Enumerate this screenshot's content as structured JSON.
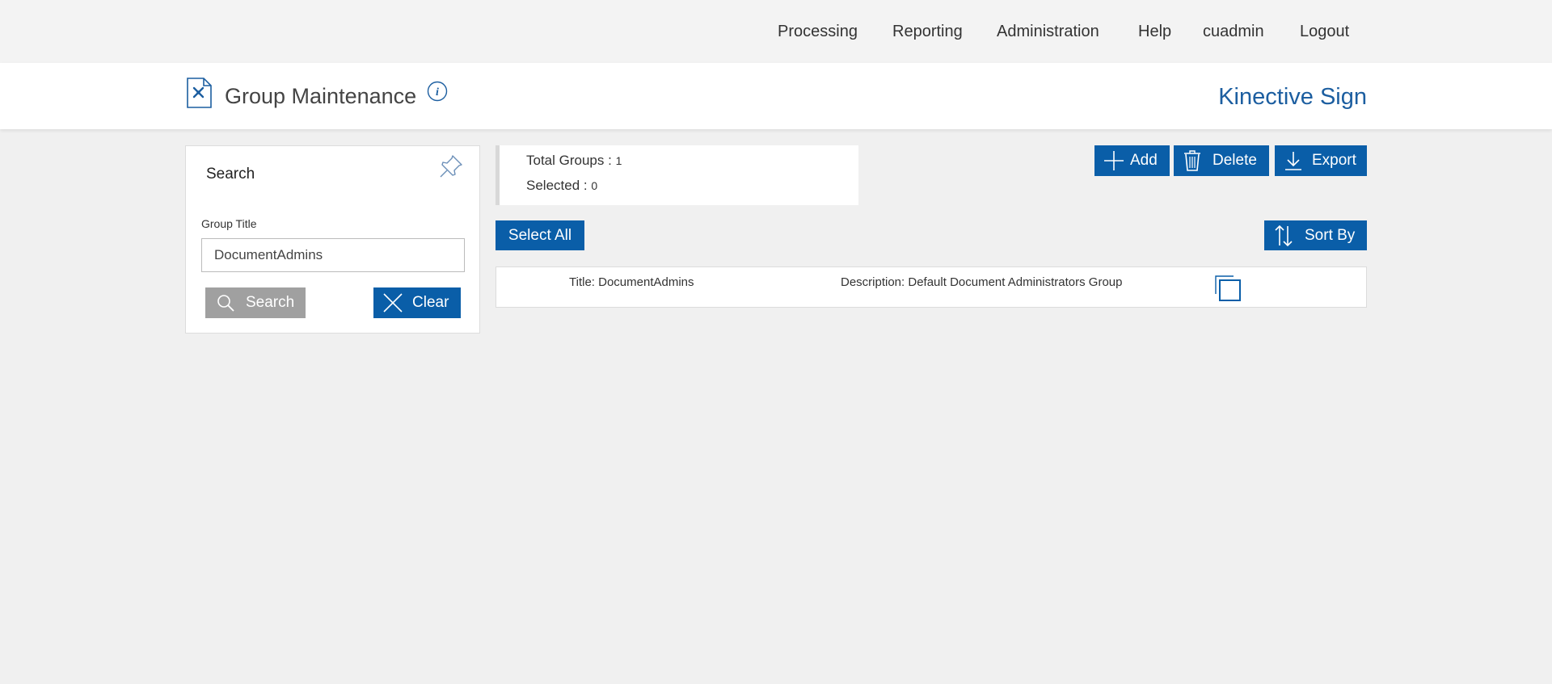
{
  "nav": {
    "items": [
      "Processing",
      "Reporting",
      "Administration",
      "Help",
      "cuadmin",
      "Logout"
    ]
  },
  "header": {
    "page_title": "Group Maintenance",
    "brand": "Kinective Sign",
    "page_icon": "document-tools-icon",
    "info_icon": "info-icon"
  },
  "search_panel": {
    "heading": "Search",
    "field_label": "Group Title",
    "field_value": "DocumentAdmins",
    "search_button": "Search",
    "clear_button": "Clear"
  },
  "stats": {
    "total_label": "Total Groups : ",
    "total_value": "1",
    "selected_label": "Selected : ",
    "selected_value": "0"
  },
  "actions": {
    "add": "Add",
    "delete": "Delete",
    "export": "Export",
    "select_all": "Select All",
    "sort_by": "Sort By"
  },
  "groups": [
    {
      "title_label": "Title: ",
      "title": "DocumentAdmins",
      "description_label": "Description: ",
      "description": "Default Document Administrators Group"
    }
  ],
  "colors": {
    "accent": "#0a5ea8",
    "brand": "#1c5ea0",
    "button_disabled": "#a0a0a0",
    "background": "#f0f0f0"
  }
}
